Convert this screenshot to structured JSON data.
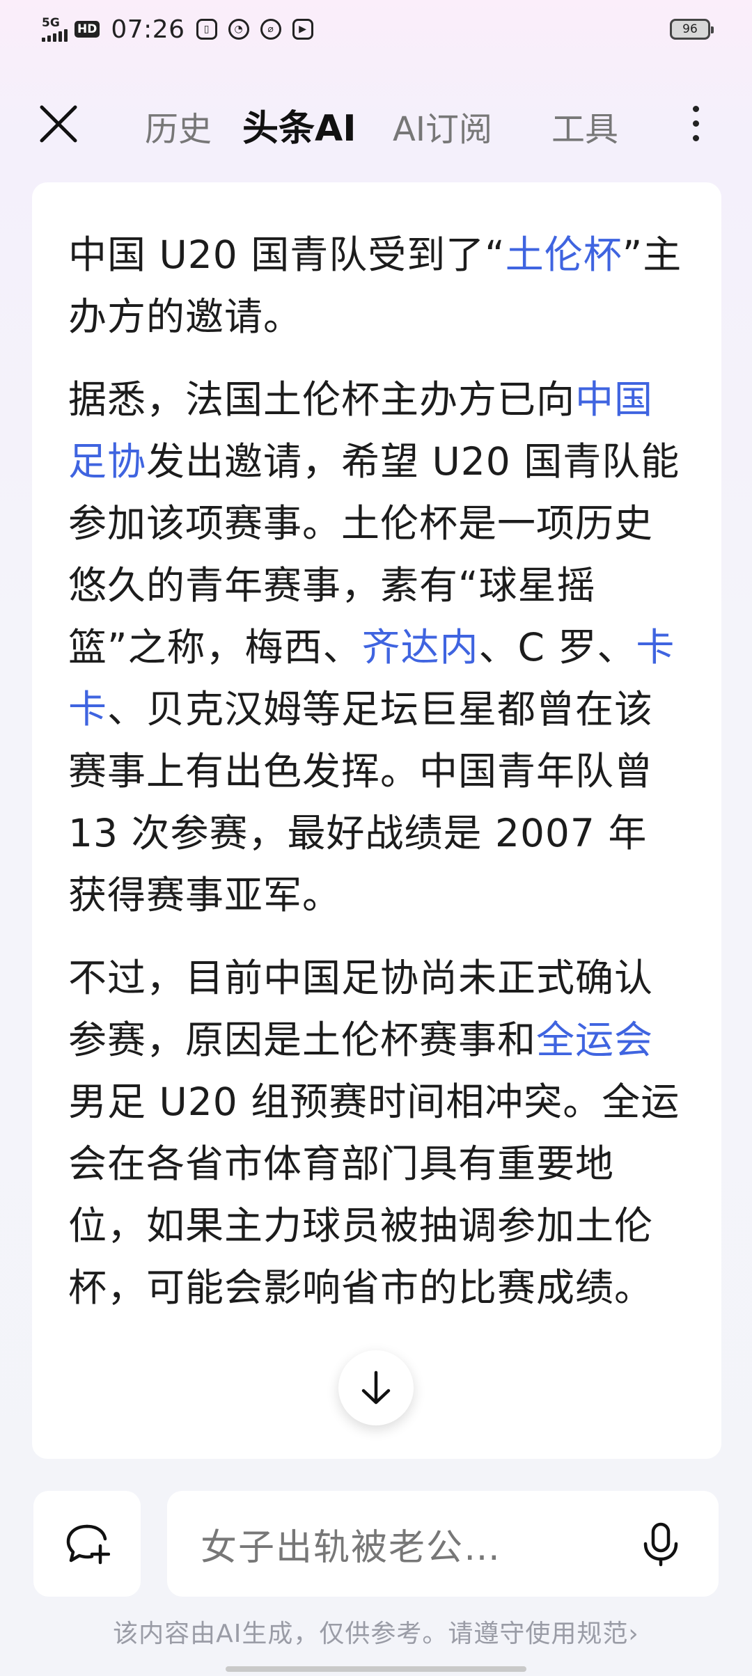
{
  "status_bar": {
    "network": "5G",
    "hd": "HD",
    "time": "07:26",
    "battery": "96"
  },
  "header": {
    "tabs": [
      {
        "label": "历史",
        "active": false
      },
      {
        "label": "头条AI",
        "active": true
      },
      {
        "label": "AI订阅",
        "active": false
      },
      {
        "label": "工具",
        "active": false
      }
    ]
  },
  "article": {
    "p1": {
      "t1": "中国 U20 国青队受到了“",
      "link1": "土伦杯",
      "t2": "”主办方的邀请。"
    },
    "p2": {
      "t1": "据悉，法国土伦杯主办方已向",
      "link1": "中国足协",
      "t2": "发出邀请，希望 U20 国青队能参加该项赛事。土伦杯是一项历史悠久的青年赛事，素有“球星摇篮”之称，梅西、",
      "link2": "齐达内",
      "t3": "、C 罗、",
      "link3": "卡卡",
      "t4": "、贝克汉姆等足坛巨星都曾在该赛事上有出色发挥。中国青年队曾 13 次参赛，最好战绩是 2007 年获得赛事亚军。"
    },
    "p3": {
      "t1": "不过，目前中国足协尚未正式确认参赛，原因是土伦杯赛事和",
      "link1": "全运会",
      "t2": "男足 U20 组预赛时间相冲突。全运会在各省市体育部门具有重要地位，如果主力球员被抽调参加土伦杯，可能会影响省市的比赛成绩。"
    }
  },
  "input": {
    "placeholder": "女子出轨被老公…"
  },
  "footer": {
    "disclaimer": "该内容由AI生成，仅供参考。请遵守使用规范",
    "chevron": "›"
  },
  "colors": {
    "link": "#3f64e0",
    "text": "#1c1c1c",
    "tab_inactive": "#777777"
  }
}
